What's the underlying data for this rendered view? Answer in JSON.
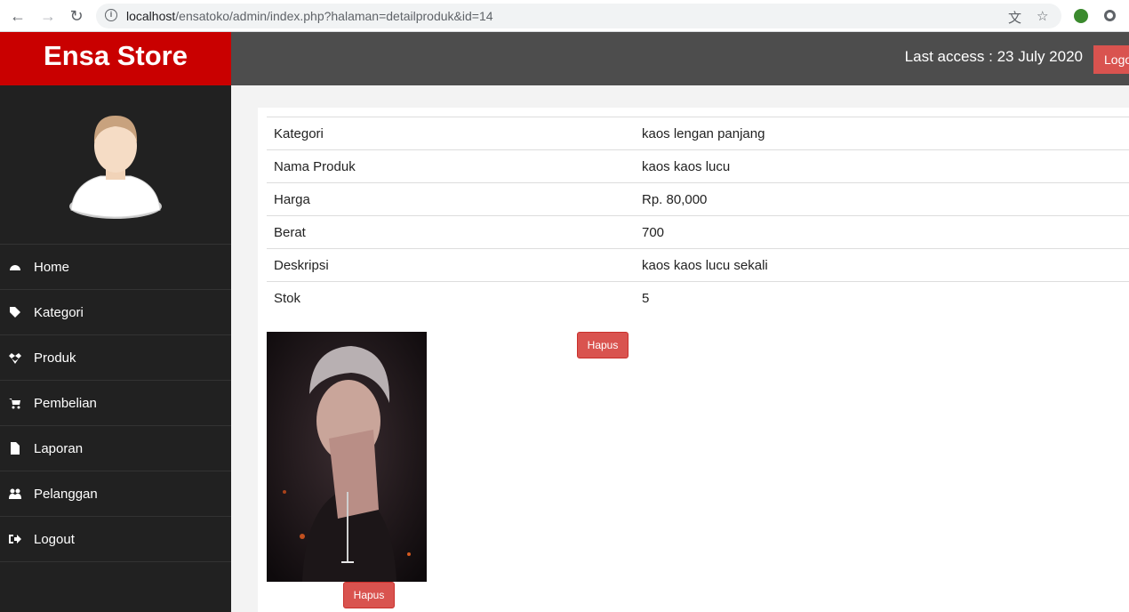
{
  "browser": {
    "url_host": "localhost",
    "url_path": "/ensatoko/admin/index.php?halaman=detailproduk&id=14"
  },
  "header": {
    "brand": "Ensa Store",
    "last_access": "Last access : 23 July 2020",
    "logout_label": "Logo"
  },
  "sidebar": {
    "items": [
      {
        "label": "Home",
        "icon": "dashboard-icon"
      },
      {
        "label": "Kategori",
        "icon": "tags-icon"
      },
      {
        "label": "Produk",
        "icon": "dropbox-icon"
      },
      {
        "label": "Pembelian",
        "icon": "cart-icon"
      },
      {
        "label": "Laporan",
        "icon": "file-icon"
      },
      {
        "label": "Pelanggan",
        "icon": "users-icon"
      },
      {
        "label": "Logout",
        "icon": "sign-out-icon"
      }
    ]
  },
  "detail": {
    "rows": [
      {
        "key": "Kategori",
        "value": "kaos lengan panjang"
      },
      {
        "key": "Nama Produk",
        "value": "kaos kaos lucu"
      },
      {
        "key": "Harga",
        "value": "Rp. 80,000"
      },
      {
        "key": "Berat",
        "value": "700"
      },
      {
        "key": "Deskripsi",
        "value": "kaos kaos lucu sekali"
      },
      {
        "key": "Stok",
        "value": "5"
      }
    ],
    "hapus_label": "Hapus",
    "photo_hapus_label": "Hapus"
  },
  "colors": {
    "brand": "#c90000",
    "topbar": "#4d4d4d",
    "sidebar": "#212121",
    "danger": "#d9534f"
  }
}
